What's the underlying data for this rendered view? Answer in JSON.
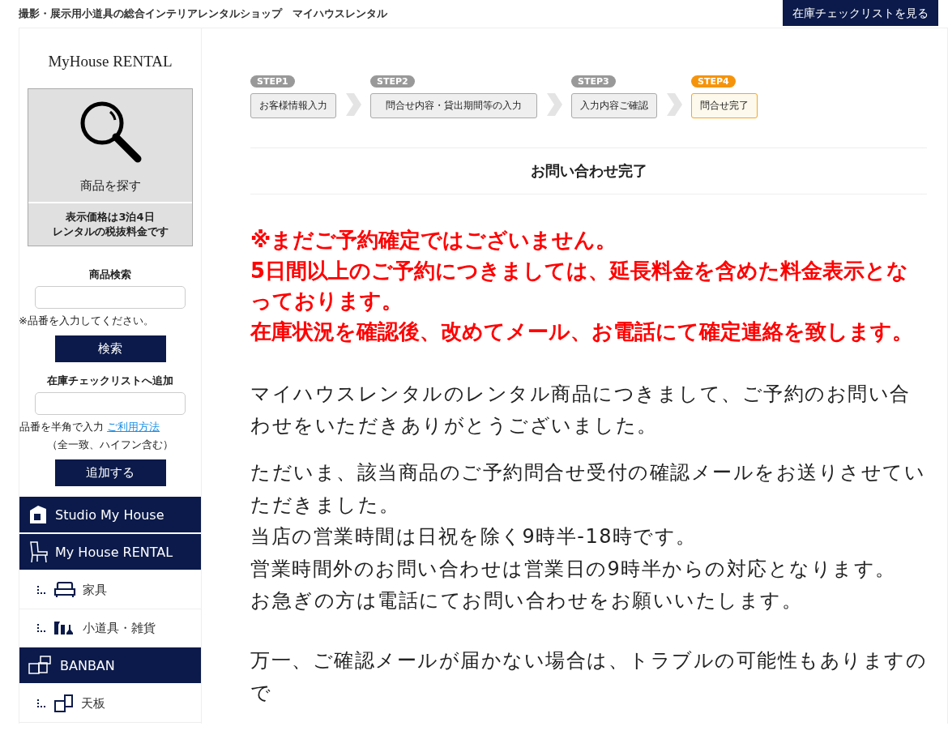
{
  "header": {
    "tagline": "撮影・展示用小道具の総合インテリアレンタルショップ　マイハウスレンタル",
    "checklist_button": "在庫チェックリストを見る"
  },
  "sidebar": {
    "logo": "MyHouse RENTAL",
    "search_card": {
      "label": "商品を探す",
      "note": [
        "表示価格は3泊4日",
        "レンタルの税抜料金です"
      ]
    },
    "product_search": {
      "heading": "商品検索",
      "hint": "※品番を入力してください。",
      "button": "検索"
    },
    "checklist_add": {
      "heading": "在庫チェックリストへ追加",
      "hint": "品番を半角で入力",
      "link": "ご利用方法",
      "note": "（全一致、ハイフン含む）",
      "button": "追加する"
    },
    "nav": [
      {
        "kind": "header",
        "label": "Studio My House"
      },
      {
        "kind": "header",
        "label": "My House RENTAL"
      },
      {
        "kind": "sub",
        "label": "家具"
      },
      {
        "kind": "sub",
        "label": "小道具・雑貨"
      },
      {
        "kind": "header",
        "label": "BANBAN"
      },
      {
        "kind": "sub",
        "label": "天板"
      }
    ]
  },
  "steps": [
    {
      "badge": "STEP1",
      "label": "お客様情報入力",
      "selected": false
    },
    {
      "badge": "STEP2",
      "label": "問合せ内容・貸出期間等の入力",
      "selected": false
    },
    {
      "badge": "STEP3",
      "label": "入力内容ご確認",
      "selected": false
    },
    {
      "badge": "STEP4",
      "label": "問合せ完了",
      "selected": true
    }
  ],
  "page_title": "お問い合わせ完了",
  "notice": [
    "※まだご予約確定ではございません。",
    "5日間以上のご予約につきましては、延長料金を含めた料金表示となっております。",
    "在庫状況を確認後、改めてメール、お電話にて確定連絡を致します。"
  ],
  "paragraphs": [
    [
      "マイハウスレンタルのレンタル商品につきまして、ご予約のお問い合わせをいただきありがとうございました。"
    ],
    [
      "ただいま、該当商品のご予約問合せ受付の確認メールをお送りさせていただきました。",
      "当店の営業時間は日祝を除く9時半-18時です。",
      "営業時間外のお問い合わせは営業日の9時半からの対応となります。",
      "お急ぎの方は電話にてお問い合わせをお願いいたします。"
    ],
    [
      "万一、ご確認メールが届かない場合は、トラブルの可能性もありますので"
    ]
  ]
}
